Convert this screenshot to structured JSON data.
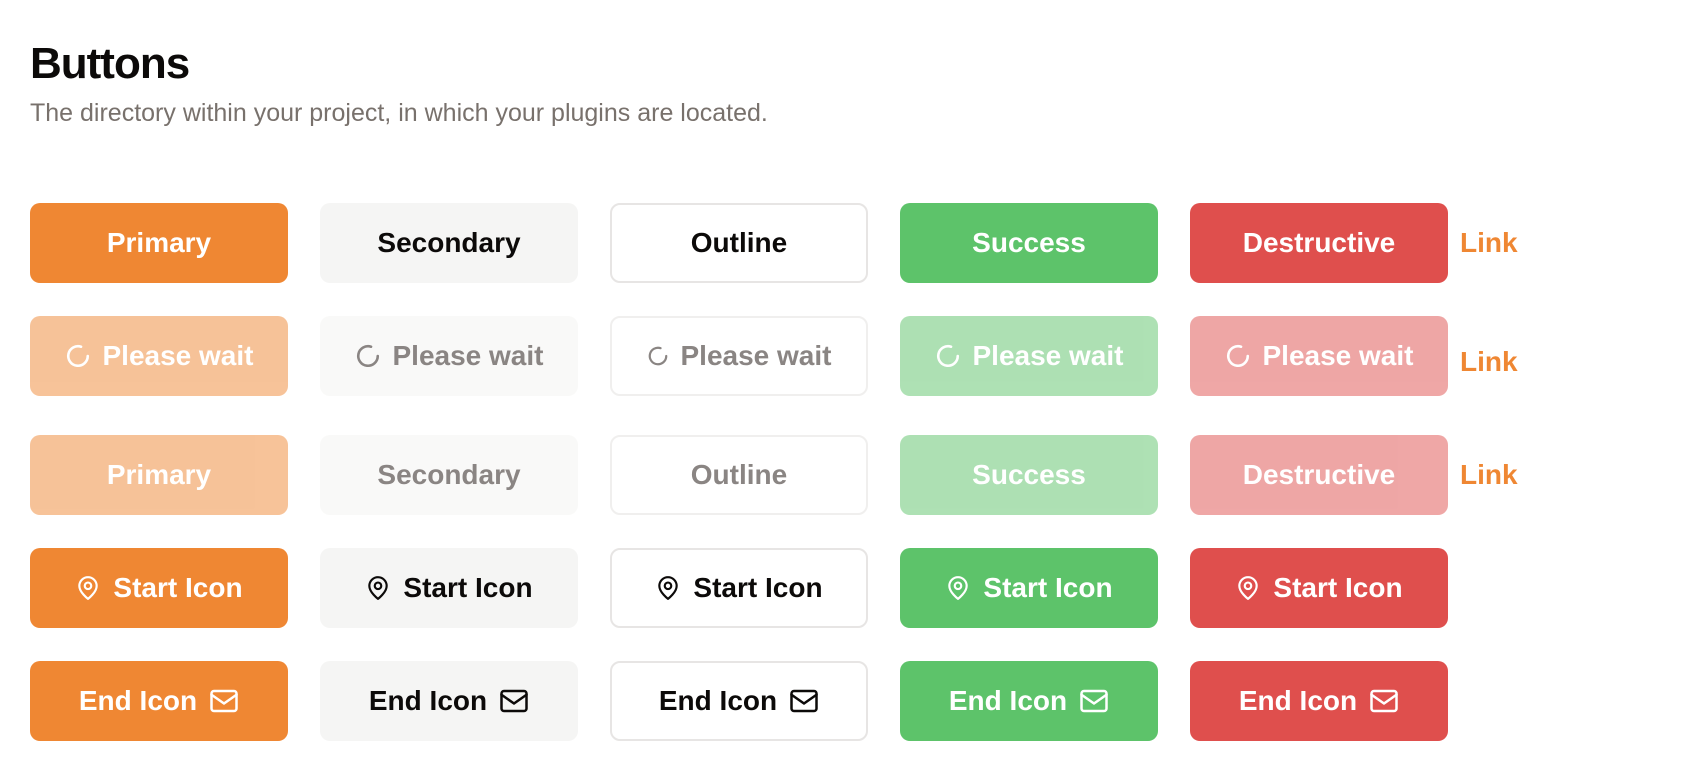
{
  "header": {
    "title": "Buttons",
    "subtitle": "The directory within your project, in which your plugins are located."
  },
  "rows": {
    "normal": {
      "primary": "Primary",
      "secondary": "Secondary",
      "outline": "Outline",
      "success": "Success",
      "destructive": "Destructive",
      "link": "Link"
    },
    "loading": {
      "label": "Please wait",
      "link": "Link",
      "icon": "spinner-icon"
    },
    "disabled": {
      "primary": "Primary",
      "secondary": "Secondary",
      "outline": "Outline",
      "success": "Success",
      "destructive": "Destructive",
      "link": "Link"
    },
    "start_icon": {
      "label": "Start Icon",
      "icon": "map-pin-icon"
    },
    "end_icon": {
      "label": "End Icon",
      "icon": "mail-icon"
    }
  },
  "colors": {
    "primary": "#ef8733",
    "secondary": "#f5f5f4",
    "success": "#5dc36a",
    "destructive": "#df4f4d",
    "muted_text": "#78716c"
  }
}
